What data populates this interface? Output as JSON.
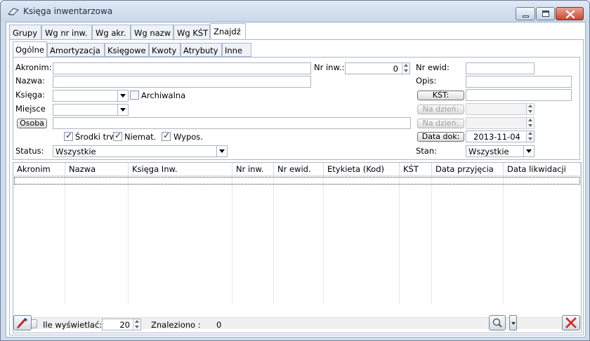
{
  "window": {
    "title": "Księga inwentarzowa"
  },
  "outer_tabs": [
    "Grupy",
    "Wg nr inw.",
    "Wg akr.",
    "Wg nazw",
    "Wg KŚT",
    "Znajdź"
  ],
  "inner_tabs": [
    "Ogólne",
    "Amortyzacja",
    "Księgowe",
    "Kwoty",
    "Atrybuty",
    "Inne"
  ],
  "filters": {
    "akronim_label": "Akronim:",
    "akronim_value": "",
    "nazwa_label": "Nazwa:",
    "nazwa_value": "",
    "ksiega_label": "Księga:",
    "ksiega_value": "",
    "archiwalna_label": "Archiwalna",
    "archiwalna_checked": false,
    "miejsce_label": "Miejsce",
    "miejsce_value": "",
    "osoba_button": "Osoba",
    "osoba_value": "",
    "srodki_label": "Środki trw",
    "srodki_checked": true,
    "niemat_label": "Niemat.",
    "niemat_checked": true,
    "wypos_label": "Wypos.",
    "wypos_checked": true,
    "status_label": "Status:",
    "status_value": "Wszystkie",
    "nrinw_label": "Nr inw.:",
    "nrinw_value": "0",
    "nrewid_label": "Nr ewid:",
    "nrewid_value": "",
    "opis_label": "Opis:",
    "opis_value": "",
    "kst_button": "KŚT:",
    "kst_value": "",
    "nadzien1_button": "Na dzień:",
    "nadzien2_button": "Na dzień:",
    "datadok_button": "Data dok:",
    "datadok_value": "2013-11-04",
    "stan_label": "Stan:",
    "stan_value": "Wszystkie"
  },
  "grid": {
    "columns": [
      "Akronim",
      "Nazwa",
      "Księga Inw.",
      "Nr inw.",
      "Nr ewid.",
      "Etykieta (Kod)",
      "KŚT",
      "Data przyjęcia",
      "Data likwidacji"
    ],
    "rows": []
  },
  "footer": {
    "ile_label": "Ile wyświetlać:",
    "ile_value": "20",
    "znaleziono_label": "Znaleziono :",
    "znaleziono_value": "0"
  }
}
